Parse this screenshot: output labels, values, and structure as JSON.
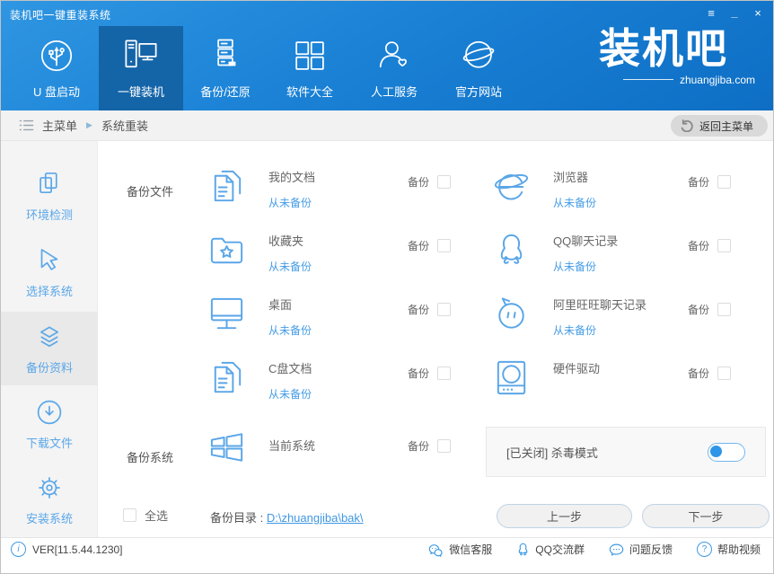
{
  "window": {
    "title": "装机吧一键重装系统",
    "controls": {
      "menu": "≡",
      "minimize": "_",
      "close": "×"
    }
  },
  "nav": {
    "items": [
      {
        "label": "U 盘启动",
        "icon": "usb-icon",
        "active": false
      },
      {
        "label": "一键装机",
        "icon": "computer-icon",
        "active": true
      },
      {
        "label": "备份/还原",
        "icon": "server-icon",
        "active": false
      },
      {
        "label": "软件大全",
        "icon": "grid-icon",
        "active": false
      },
      {
        "label": "人工服务",
        "icon": "person-heart-icon",
        "active": false
      },
      {
        "label": "官方网站",
        "icon": "globe-icon",
        "active": false
      }
    ],
    "logo": {
      "text": "装机吧",
      "domain": "zhuangjiba.com"
    }
  },
  "breadcrumb": {
    "root": "主菜单",
    "separator": "▶",
    "current": "系统重装",
    "back_button": "返回主菜单"
  },
  "sidebar": {
    "items": [
      {
        "label": "环境检测",
        "icon": "windows-stack-icon",
        "active": false
      },
      {
        "label": "选择系统",
        "icon": "cursor-icon",
        "active": false
      },
      {
        "label": "备份资料",
        "icon": "layers-icon",
        "active": true
      },
      {
        "label": "下载文件",
        "icon": "download-icon",
        "active": false
      },
      {
        "label": "安装系统",
        "icon": "gear-icon",
        "active": false
      }
    ]
  },
  "main": {
    "backup_files_label": "备份文件",
    "backup_system_label": "备份系统",
    "backup_checkbox_label": "备份",
    "file_items_left": [
      {
        "name": "我的文档",
        "icon": "documents-icon",
        "status": "从未备份"
      },
      {
        "name": "收藏夹",
        "icon": "folder-star-icon",
        "status": "从未备份"
      },
      {
        "name": "桌面",
        "icon": "desktop-icon",
        "status": "从未备份"
      },
      {
        "name": "C盘文档",
        "icon": "documents-icon",
        "status": "从未备份"
      }
    ],
    "file_items_right": [
      {
        "name": "浏览器",
        "icon": "browser-icon",
        "status": "从未备份"
      },
      {
        "name": "QQ聊天记录",
        "icon": "qq-icon",
        "status": "从未备份"
      },
      {
        "name": "阿里旺旺聊天记录",
        "icon": "aliwangwang-icon",
        "status": "从未备份"
      },
      {
        "name": "硬件驱动",
        "icon": "hardware-icon",
        "status": ""
      }
    ],
    "system_item": {
      "name": "当前系统",
      "icon": "windows-logo-icon"
    },
    "antivirus": {
      "label": "[已关闭] 杀毒模式",
      "state": "off"
    },
    "select_all_label": "全选",
    "backup_dir_label": "备份目录 : ",
    "backup_dir_path": "D:\\zhuangjiba\\bak\\",
    "prev_button": "上一步",
    "next_button": "下一步"
  },
  "statusbar": {
    "version": "VER[11.5.44.1230]",
    "info_glyph": "i",
    "links": [
      {
        "label": "微信客服",
        "icon": "wechat-icon"
      },
      {
        "label": "QQ交流群",
        "icon": "qq-icon"
      },
      {
        "label": "问题反馈",
        "icon": "feedback-bubble-icon"
      },
      {
        "label": "帮助视频",
        "icon": "help-icon",
        "glyph": "?"
      }
    ]
  },
  "colors": {
    "header_top": "#2f96e2",
    "header_bottom": "#0d6ec4",
    "nav_active": "#1464a8",
    "accent": "#5aa6e8",
    "link": "#459ce6",
    "sidebar_bg": "#f4f4f4",
    "sidebar_active": "#e9e9e9",
    "breadcrumb_bg": "#f2f2f2",
    "panel_bg": "#f8f8f8",
    "button_border": "#bed3e6"
  }
}
